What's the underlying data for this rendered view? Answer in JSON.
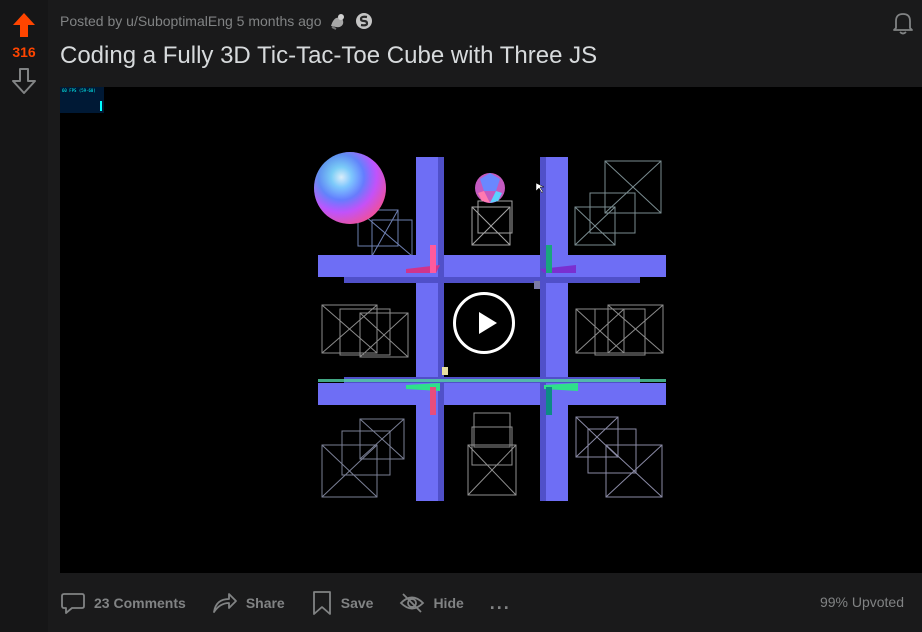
{
  "post": {
    "score": "316",
    "meta": "Posted by u/SuboptimalEng 5 months ago",
    "title": "Coding a Fully 3D Tic-Tac-Toe Cube with Three JS"
  },
  "video": {
    "fps_label": "60 FPS (59-60)"
  },
  "actions": {
    "comments": "23 Comments",
    "share": "Share",
    "save": "Save",
    "hide": "Hide",
    "more": "...",
    "upvoted": "99% Upvoted"
  },
  "colors": {
    "upvote": "#ff4500",
    "board": "#6e6ef5",
    "background": "#1a1a1b"
  },
  "icons": [
    "upvote-arrow-icon",
    "downvote-arrow-icon",
    "award-icon",
    "silver-award-icon",
    "bell-icon",
    "play-icon",
    "comment-icon",
    "share-icon",
    "save-icon",
    "hide-icon",
    "more-icon"
  ]
}
